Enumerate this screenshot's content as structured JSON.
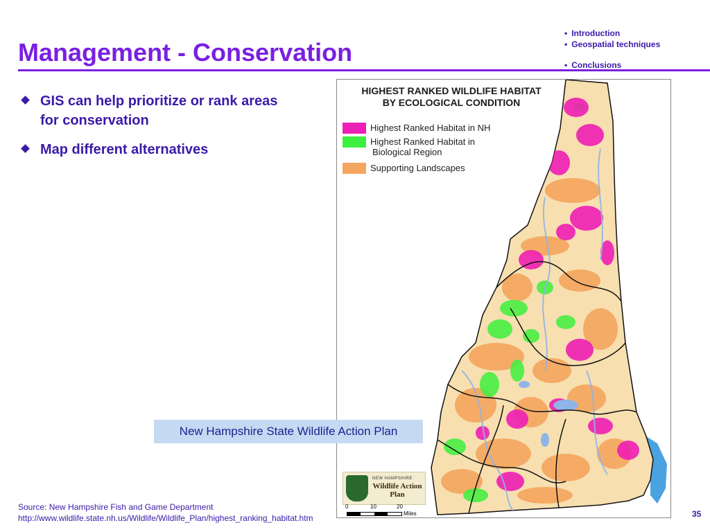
{
  "slide": {
    "title": "Management - Conservation",
    "nav": [
      "Introduction",
      "Geospatial techniques",
      "Conclusions"
    ],
    "bullets": [
      "GIS can help prioritize or rank areas for conservation",
      "Map different alternatives"
    ],
    "caption": "New Hampshire State Wildlife Action Plan",
    "source_line1": "Source:  New Hampshire Fish and Game Department",
    "source_line2": "http://www.wildlife.state.nh.us/Wildlife/Wildlife_Plan/highest_ranking_habitat.htm",
    "page_number": "35"
  },
  "map": {
    "title_line1": "HIGHEST RANKED WILDLIFE HABITAT",
    "title_line2": "BY ECOLOGICAL CONDITION",
    "legend": [
      {
        "label": "Highest Ranked Habitat in NH",
        "color": "#ee1fb4"
      },
      {
        "label": "Highest Ranked Habitat in",
        "label2": "Biological Region",
        "color": "#3ef03e"
      },
      {
        "label": "Supporting Landscapes",
        "color": "#f4a65e"
      }
    ],
    "logo_small": "NEW HAMPSHIRE",
    "logo_text": "Wildlife Action Plan",
    "scale_ticks": [
      "0",
      "10",
      "20"
    ],
    "scale_unit": "Miles",
    "colors": {
      "base": "#f7dfb0",
      "water": "#8fb4e8",
      "boundary": "#111111",
      "ocean": "#4aa3e0"
    }
  },
  "theme": {
    "accent": "#7a1fe0",
    "text": "#3a1aa8",
    "caption_bg": "#c5daf2"
  }
}
